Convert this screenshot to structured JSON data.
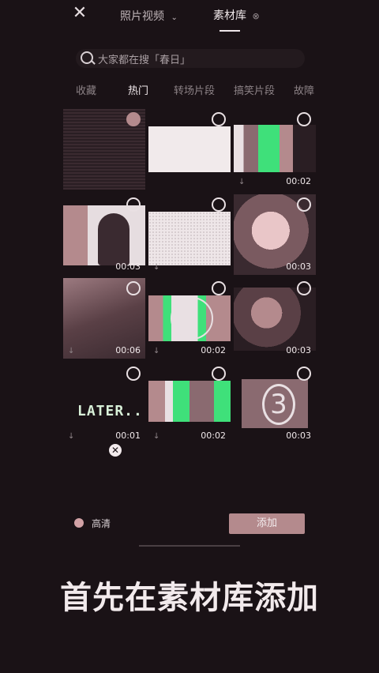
{
  "header": {
    "close_icon": "close-icon",
    "tab_photo": "照片视频",
    "tab_material": "素材库",
    "tab_photo_arrow": "chevron-down-icon"
  },
  "search": {
    "placeholder": "大家都在搜「春日」"
  },
  "categories": [
    "收藏",
    "热门",
    "转场片段",
    "搞笑片段",
    "故障"
  ],
  "active_category_index": 1,
  "grid": {
    "items": [
      {
        "duration": ""
      },
      {
        "duration": ""
      },
      {
        "duration": "00:02"
      },
      {
        "duration": "00:03"
      },
      {
        "duration": ""
      },
      {
        "duration": "00:03"
      },
      {
        "duration": "00:06"
      },
      {
        "duration": "00:02"
      },
      {
        "duration": "00:03"
      },
      {
        "duration": "00:01",
        "label": "LATER..."
      },
      {
        "duration": "00:02"
      },
      {
        "duration": "00:03",
        "label": "3"
      }
    ]
  },
  "footer": {
    "hq_label": "高清",
    "add_label": "添加"
  },
  "caption": "首先在素材库添加",
  "colors": {
    "background": "#1a1216",
    "accent": "#b48a8d",
    "green": "#3fe07a"
  }
}
